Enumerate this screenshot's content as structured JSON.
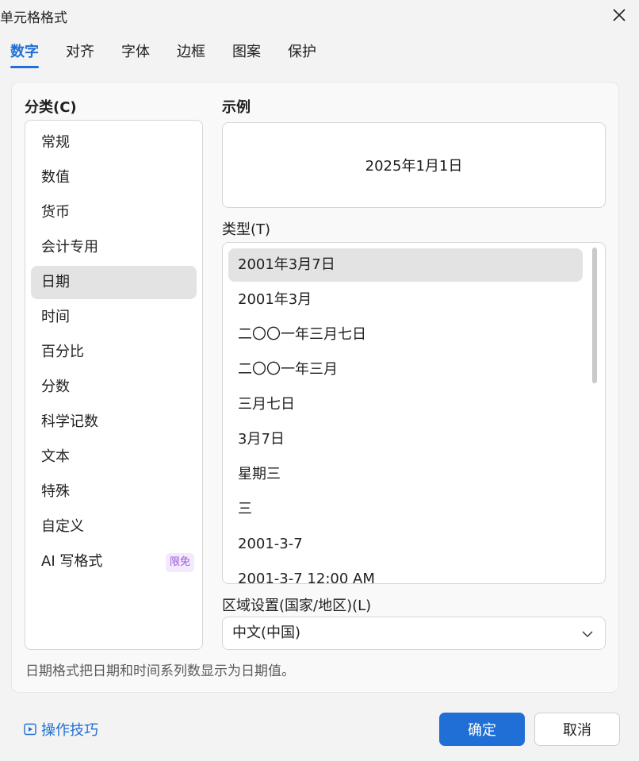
{
  "window": {
    "title": "单元格格式"
  },
  "tabs": [
    {
      "label": "数字",
      "active": true
    },
    {
      "label": "对齐"
    },
    {
      "label": "字体"
    },
    {
      "label": "边框"
    },
    {
      "label": "图案"
    },
    {
      "label": "保护"
    }
  ],
  "category": {
    "label": "分类(C)",
    "items": [
      {
        "label": "常规"
      },
      {
        "label": "数值"
      },
      {
        "label": "货币"
      },
      {
        "label": "会计专用"
      },
      {
        "label": "日期",
        "selected": true
      },
      {
        "label": "时间"
      },
      {
        "label": "百分比"
      },
      {
        "label": "分数"
      },
      {
        "label": "科学记数"
      },
      {
        "label": "文本"
      },
      {
        "label": "特殊"
      },
      {
        "label": "自定义"
      },
      {
        "label": "AI 写格式",
        "badge": "限免"
      }
    ]
  },
  "sample": {
    "label": "示例",
    "value": "2025年1月1日"
  },
  "type": {
    "label": "类型(T)",
    "items": [
      {
        "label": "2001年3月7日",
        "selected": true
      },
      {
        "label": "2001年3月"
      },
      {
        "label": "二〇〇一年三月七日"
      },
      {
        "label": "二〇〇一年三月"
      },
      {
        "label": "三月七日"
      },
      {
        "label": "3月7日"
      },
      {
        "label": "星期三"
      },
      {
        "label": "三"
      },
      {
        "label": "2001-3-7"
      },
      {
        "label": "2001-3-7 12:00 AM"
      }
    ]
  },
  "region": {
    "label": "区域设置(国家/地区)(L)",
    "value": "中文(中国)"
  },
  "description": "日期格式把日期和时间系列数显示为日期值。",
  "footer": {
    "tips_label": "操作技巧",
    "ok_label": "确定",
    "cancel_label": "取消"
  },
  "colors": {
    "accent": "#1f6fd6",
    "badge": "#9b59d9"
  }
}
